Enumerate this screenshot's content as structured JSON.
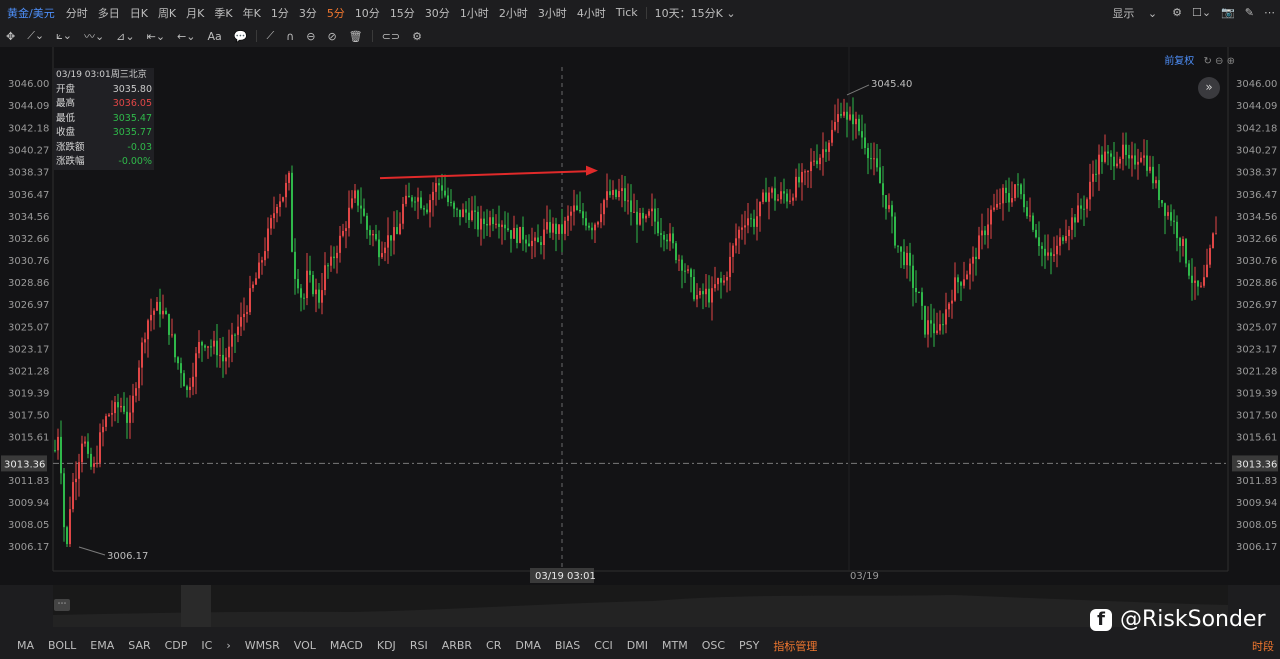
{
  "topbar": {
    "symbol": "黄金/美元",
    "timeframes": [
      "分时",
      "多日",
      "日K",
      "周K",
      "月K",
      "季K",
      "年K",
      "1分",
      "3分",
      "5分",
      "10分",
      "15分",
      "30分",
      "1小时",
      "2小时",
      "3小时",
      "4小时",
      "Tick"
    ],
    "active_timeframe": "5分",
    "range_select": "10天：15分K",
    "display_label": "显示"
  },
  "tools": {
    "text_tool": "Aa"
  },
  "chart": {
    "adjust_label": "前复权",
    "high_label": "3045.40",
    "low_label": "3006.17",
    "current_price": "3013.36",
    "crosshair_time": "03/19 03:01",
    "date_label": "03/19"
  },
  "infobox": {
    "header": "03/19 03:01周三北京",
    "rows": [
      {
        "label": "开盘",
        "value": "3035.80",
        "color": "#c8c8c8"
      },
      {
        "label": "最高",
        "value": "3036.05",
        "color": "#e04646"
      },
      {
        "label": "最低",
        "value": "3035.47",
        "color": "#2fb84a"
      },
      {
        "label": "收盘",
        "value": "3035.77",
        "color": "#2fb84a"
      },
      {
        "label": "涨跌额",
        "value": "-0.03",
        "color": "#2fb84a"
      },
      {
        "label": "涨跌幅",
        "value": "-0.00%",
        "color": "#2fb84a"
      }
    ]
  },
  "chart_data": {
    "type": "candlestick",
    "y_axis_ticks": [
      "3046.00",
      "3044.09",
      "3042.18",
      "3040.27",
      "3038.37",
      "3036.47",
      "3034.56",
      "3032.66",
      "3030.76",
      "3028.86",
      "3026.97",
      "3025.07",
      "3023.17",
      "3021.28",
      "3019.39",
      "3017.50",
      "3015.61",
      "3013.36",
      "3011.83",
      "3009.94",
      "3008.05",
      "3006.17"
    ],
    "ylim": [
      3006.17,
      3046.0
    ],
    "current_price": 3013.36,
    "high": 3045.4,
    "low": 3006.17,
    "x_labels": [
      "03/19 03:01",
      "03/19"
    ],
    "up_color": "#e04646",
    "down_color": "#2fb84a",
    "path_points": [
      [
        0,
        3014.5
      ],
      [
        4,
        3016.5
      ],
      [
        9,
        3008
      ],
      [
        12,
        3006.2
      ],
      [
        16,
        3011
      ],
      [
        22,
        3013
      ],
      [
        28,
        3016
      ],
      [
        34,
        3013
      ],
      [
        40,
        3013
      ],
      [
        45,
        3015.5
      ],
      [
        52,
        3017.5
      ],
      [
        60,
        3018
      ],
      [
        68,
        3018.5
      ],
      [
        74,
        3016.5
      ],
      [
        80,
        3020
      ],
      [
        86,
        3023
      ],
      [
        92,
        3025.6
      ],
      [
        98,
        3026.5
      ],
      [
        104,
        3026.8
      ],
      [
        110,
        3026
      ],
      [
        116,
        3024.5
      ],
      [
        120,
        3022.5
      ],
      [
        126,
        3021.5
      ],
      [
        132,
        3019.5
      ],
      [
        138,
        3021.5
      ],
      [
        144,
        3023.5
      ],
      [
        150,
        3023.9
      ],
      [
        156,
        3023.5
      ],
      [
        162,
        3023.2
      ],
      [
        168,
        3022.2
      ],
      [
        174,
        3023
      ],
      [
        180,
        3024.5
      ],
      [
        186,
        3025.6
      ],
      [
        192,
        3027
      ],
      [
        198,
        3028.5
      ],
      [
        204,
        3030
      ],
      [
        210,
        3032
      ],
      [
        216,
        3034
      ],
      [
        222,
        3036
      ],
      [
        228,
        3036.5
      ],
      [
        234,
        3037.8
      ],
      [
        238,
        3030
      ],
      [
        242,
        3029.5
      ],
      [
        248,
        3027
      ],
      [
        252,
        3029.4
      ],
      [
        258,
        3028.5
      ],
      [
        264,
        3027.5
      ],
      [
        270,
        3030
      ],
      [
        276,
        3030.5
      ],
      [
        282,
        3032
      ],
      [
        288,
        3033.2
      ],
      [
        294,
        3035
      ],
      [
        300,
        3036.3
      ],
      [
        306,
        3035.5
      ],
      [
        312,
        3033.5
      ],
      [
        318,
        3033
      ],
      [
        324,
        3031.8
      ],
      [
        330,
        3032.5
      ],
      [
        336,
        3033
      ],
      [
        342,
        3033
      ],
      [
        348,
        3035.5
      ],
      [
        354,
        3036
      ],
      [
        360,
        3036.5
      ],
      [
        366,
        3035.9
      ],
      [
        372,
        3035.5
      ],
      [
        380,
        3037.2
      ],
      [
        386,
        3037.4
      ],
      [
        392,
        3036
      ],
      [
        400,
        3034.8
      ],
      [
        408,
        3034.9
      ],
      [
        416,
        3035
      ],
      [
        424,
        3033.7
      ],
      [
        432,
        3034.3
      ],
      [
        440,
        3034.6
      ],
      [
        448,
        3034.2
      ],
      [
        456,
        3033.2
      ],
      [
        462,
        3033
      ],
      [
        468,
        3033
      ],
      [
        476,
        3032.5
      ],
      [
        482,
        3032
      ],
      [
        488,
        3033
      ],
      [
        494,
        3033.7
      ],
      [
        500,
        3033.5
      ],
      [
        506,
        3033.2
      ],
      [
        512,
        3034.2
      ],
      [
        518,
        3035.3
      ],
      [
        524,
        3034.7
      ],
      [
        530,
        3034.4
      ],
      [
        536,
        3033.8
      ],
      [
        542,
        3034.3
      ],
      [
        548,
        3035.9
      ],
      [
        554,
        3036.5
      ],
      [
        560,
        3036.2
      ],
      [
        566,
        3036.8
      ],
      [
        572,
        3035.8
      ],
      [
        578,
        3034.8
      ],
      [
        584,
        3034.3
      ],
      [
        590,
        3033.9
      ],
      [
        596,
        3035
      ],
      [
        602,
        3033.8
      ],
      [
        608,
        3033.4
      ],
      [
        614,
        3032.8
      ],
      [
        620,
        3031.5
      ],
      [
        626,
        3030.8
      ],
      [
        632,
        3029.8
      ],
      [
        638,
        3028.2
      ],
      [
        644,
        3027.5
      ],
      [
        650,
        3028.1
      ],
      [
        656,
        3027.6
      ],
      [
        662,
        3029
      ],
      [
        668,
        3028.7
      ],
      [
        674,
        3030.5
      ],
      [
        680,
        3032.5
      ],
      [
        686,
        3033.8
      ],
      [
        692,
        3034.7
      ],
      [
        698,
        3034
      ],
      [
        704,
        3035
      ],
      [
        710,
        3036.5
      ],
      [
        716,
        3036.8
      ],
      [
        722,
        3036
      ],
      [
        728,
        3036.6
      ],
      [
        734,
        3036.1
      ],
      [
        740,
        3037.3
      ],
      [
        746,
        3037.7
      ],
      [
        752,
        3038
      ],
      [
        758,
        3039.6
      ],
      [
        764,
        3039.7
      ],
      [
        770,
        3040.7
      ],
      [
        776,
        3041.6
      ],
      [
        782,
        3043
      ],
      [
        788,
        3044.4
      ],
      [
        792,
        3042.6
      ],
      [
        798,
        3043.1
      ],
      [
        804,
        3042
      ],
      [
        810,
        3041
      ],
      [
        816,
        3039.6
      ],
      [
        822,
        3038.4
      ],
      [
        828,
        3036.5
      ],
      [
        834,
        3035.2
      ],
      [
        840,
        3032.7
      ],
      [
        846,
        3031.3
      ],
      [
        852,
        3030.8
      ],
      [
        858,
        3028.8
      ],
      [
        864,
        3027.6
      ],
      [
        870,
        3025
      ],
      [
        876,
        3025.6
      ],
      [
        882,
        3024.2
      ],
      [
        888,
        3025.8
      ],
      [
        894,
        3027.3
      ],
      [
        900,
        3028.8
      ],
      [
        906,
        3029.2
      ],
      [
        912,
        3029.9
      ],
      [
        918,
        3030.7
      ],
      [
        924,
        3032.3
      ],
      [
        930,
        3033.5
      ],
      [
        936,
        3035
      ],
      [
        942,
        3035.3
      ],
      [
        948,
        3036.5
      ],
      [
        954,
        3036
      ],
      [
        960,
        3037.4
      ],
      [
        966,
        3036.4
      ],
      [
        972,
        3035.3
      ],
      [
        978,
        3034
      ],
      [
        984,
        3032.5
      ],
      [
        990,
        3031.1
      ],
      [
        996,
        3031
      ],
      [
        1002,
        3031.8
      ],
      [
        1008,
        3033.1
      ],
      [
        1014,
        3034
      ],
      [
        1020,
        3034.6
      ],
      [
        1026,
        3035.3
      ],
      [
        1032,
        3036.1
      ],
      [
        1038,
        3038.3
      ],
      [
        1044,
        3039.5
      ],
      [
        1050,
        3039.8
      ],
      [
        1056,
        3039.4
      ],
      [
        1062,
        3039.8
      ],
      [
        1068,
        3040.1
      ],
      [
        1074,
        3039
      ],
      [
        1080,
        3039.5
      ],
      [
        1086,
        3040.2
      ],
      [
        1092,
        3039.2
      ],
      [
        1098,
        3037.8
      ],
      [
        1104,
        3036.5
      ],
      [
        1110,
        3035.3
      ],
      [
        1116,
        3034.6
      ],
      [
        1122,
        3033.3
      ],
      [
        1128,
        3032
      ],
      [
        1134,
        3030
      ],
      [
        1140,
        3028.4
      ],
      [
        1146,
        3028.2
      ],
      [
        1152,
        3029.8
      ],
      [
        1157,
        3032.5
      ],
      [
        1162,
        3033.8
      ]
    ]
  },
  "indicators": [
    "MA",
    "BOLL",
    "EMA",
    "SAR",
    "CDP",
    "IC",
    "WMSR",
    "VOL",
    "MACD",
    "KDJ",
    "RSI",
    "ARBR",
    "CR",
    "DMA",
    "BIAS",
    "CCI",
    "DMI",
    "MTM",
    "OSC",
    "PSY"
  ],
  "indicator_manager": "指标管理",
  "period_label": "时段",
  "watermark": "@RiskSonder"
}
